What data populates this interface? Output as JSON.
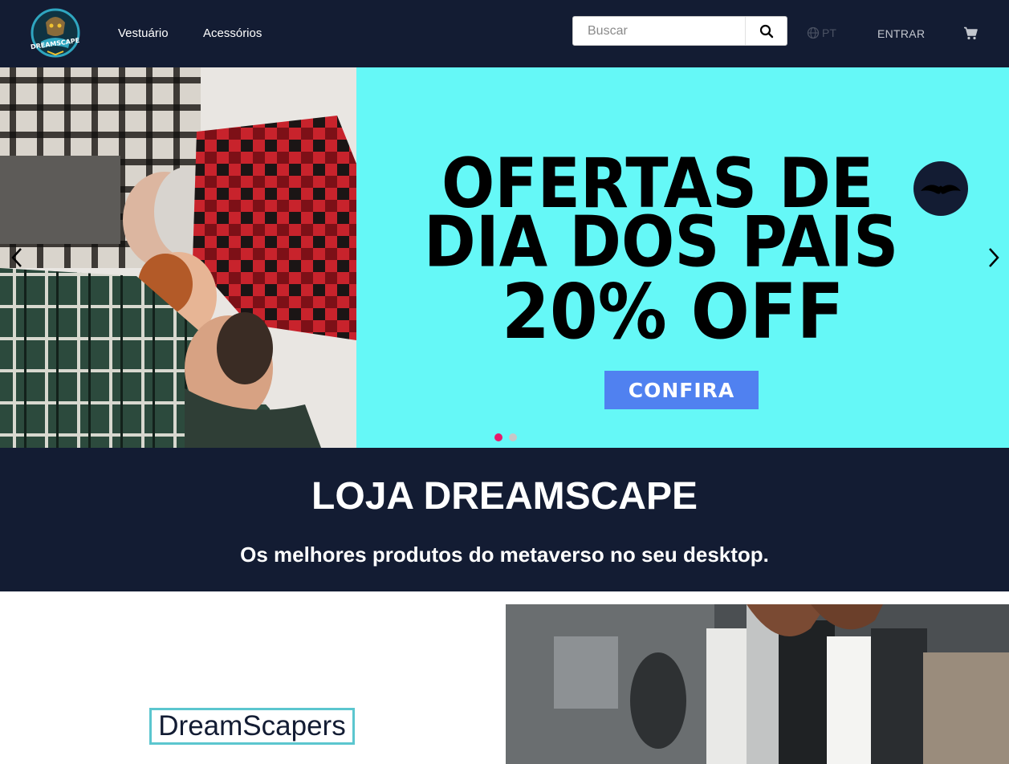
{
  "header": {
    "nav": [
      "Vestuário",
      "Acessórios"
    ],
    "search_placeholder": "Buscar",
    "language": "PT",
    "login_label": "ENTRAR",
    "colors": {
      "background": "#131c33",
      "logo_ring": "#2fa6c0",
      "logo_accent": "#f1c331"
    }
  },
  "hero": {
    "promo_lines": [
      "OFERTAS DE",
      "DIA DOS PAIS",
      "20% OFF"
    ],
    "cta_label": "CONFIRA",
    "colors": {
      "background": "#65f8f7",
      "cta": "#5081f0",
      "dot_active": "#e8196a",
      "dot_inactive": "#c7c7c7"
    },
    "slides": 2,
    "active_slide": 1
  },
  "band": {
    "title": "LOJA DREAMSCAPE",
    "subtitle": "Os melhores produtos do metaverso no seu desktop."
  },
  "brand": {
    "name": "DreamScapers",
    "border_color": "#5bc6cf"
  }
}
